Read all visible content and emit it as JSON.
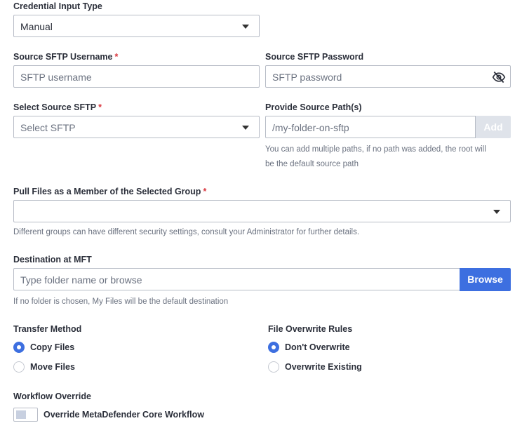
{
  "credential": {
    "label": "Credential Input Type",
    "value": "Manual"
  },
  "username": {
    "label": "Source SFTP Username",
    "required": "*",
    "placeholder": "SFTP username"
  },
  "password": {
    "label": "Source SFTP Password",
    "placeholder": "SFTP password",
    "icon": "eye-slash-icon"
  },
  "sftp": {
    "label": "Select Source SFTP",
    "required": "*",
    "placeholder": "Select SFTP"
  },
  "path": {
    "label": "Provide Source Path(s)",
    "placeholder": "/my-folder-on-sftp",
    "add_label": "Add",
    "help_line1": "You can add multiple paths, if no path was added, the root will",
    "help_line2": "be the default source path"
  },
  "group": {
    "label": "Pull Files as a Member of the Selected Group",
    "required": "*",
    "value": "",
    "help": "Different groups can have different security settings, consult your Administrator for further details."
  },
  "destination": {
    "label": "Destination at MFT",
    "placeholder": "Type folder name or browse",
    "browse_label": "Browse",
    "help": "If no folder is chosen, My Files will be the default destination"
  },
  "transfer": {
    "label": "Transfer Method",
    "options": [
      {
        "label": "Copy Files",
        "selected": true
      },
      {
        "label": "Move Files",
        "selected": false
      }
    ]
  },
  "overwrite": {
    "label": "File Overwrite Rules",
    "options": [
      {
        "label": "Don't Overwrite",
        "selected": true
      },
      {
        "label": "Overwrite Existing",
        "selected": false
      }
    ]
  },
  "workflow": {
    "label": "Workflow Override",
    "toggle_label": "Override MetaDefender Core Workflow",
    "enabled": false
  },
  "colors": {
    "accent": "#3d6fe0",
    "required": "#d9363e",
    "border": "#b7bcc6",
    "add_disabled": "#dfe3ea"
  }
}
